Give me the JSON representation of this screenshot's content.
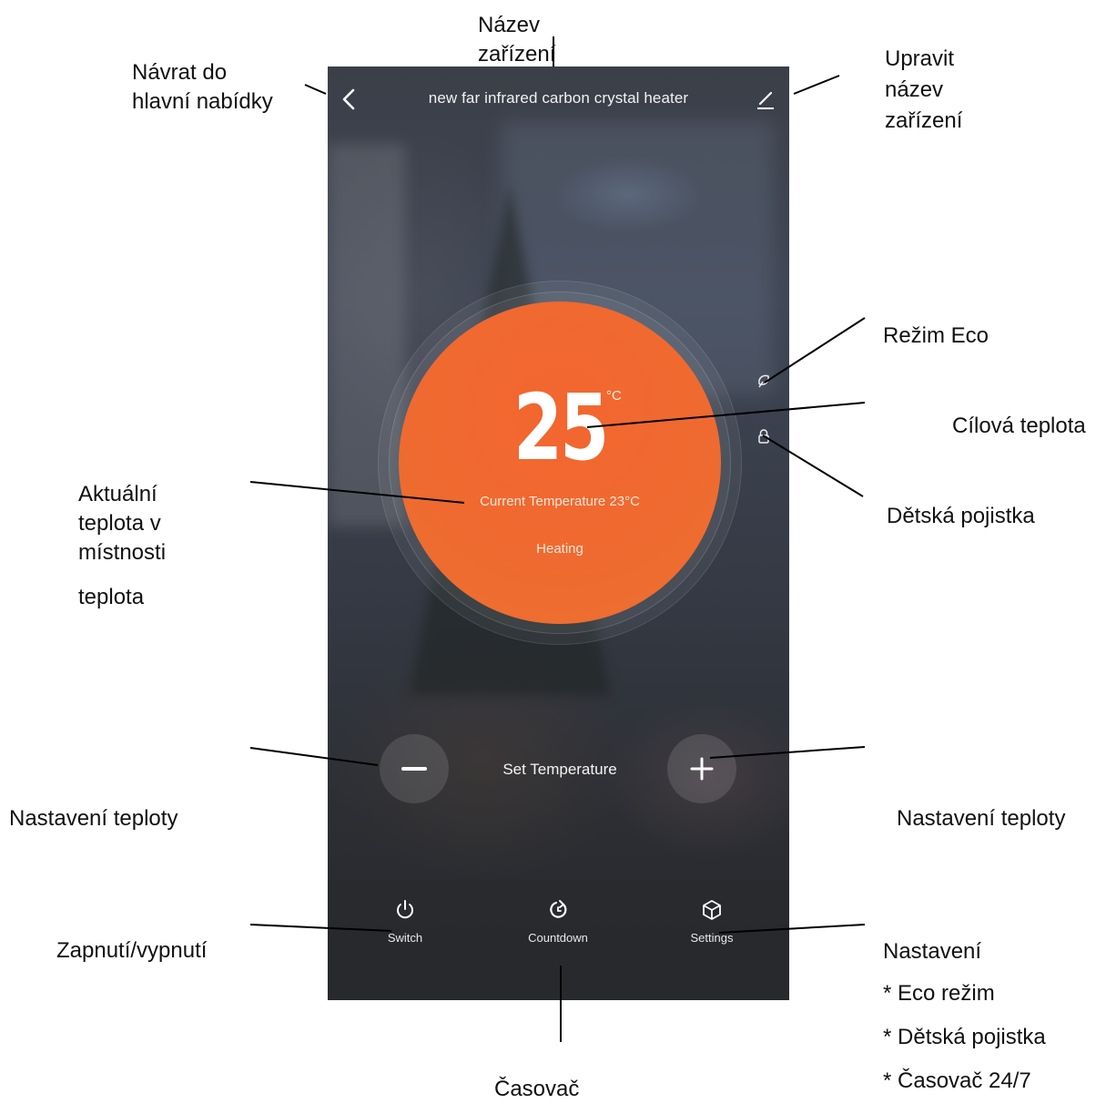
{
  "app": {
    "device_title": "new far infrared carbon crystal heater",
    "target_temperature": "25",
    "unit": "°C",
    "current_temperature": "Current Temperature 23°C",
    "status": "Heating",
    "set_temperature_label": "Set Temperature",
    "tabs": [
      {
        "label": "Switch",
        "icon": "power-icon"
      },
      {
        "label": "Countdown",
        "icon": "countdown-icon"
      },
      {
        "label": "Settings",
        "icon": "settings-cube-icon"
      }
    ],
    "colors": {
      "accent": "#ef6a30",
      "background": "#353a45"
    }
  },
  "annotations": {
    "device_name": [
      "Název",
      "zařízení"
    ],
    "back": [
      "Návrat do",
      "hlavní nabídky"
    ],
    "edit_name": [
      "Upravit",
      "název",
      "zařízení"
    ],
    "eco_mode": "Režim Eco",
    "target_temp": "Cílová teplota",
    "child_lock": "Dětská pojistka",
    "current_room_temp": [
      "Aktuální",
      "teplota v",
      "místnosti",
      "teplota"
    ],
    "set_temp_left": "Nastavení teploty",
    "set_temp_right": "Nastavení teploty",
    "power": "Zapnutí/vypnutí",
    "timer": "Časovač",
    "settings": [
      "Nastavení",
      "* Eco režim",
      "* Dětská pojistka",
      "* Časovač 24/7"
    ]
  }
}
